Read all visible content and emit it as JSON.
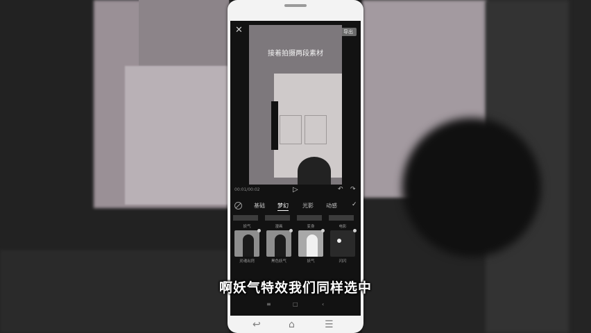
{
  "video": {
    "caption": "接着拍摄两段素材",
    "timecode": "00:01/00:02"
  },
  "toolbar": {
    "close_icon": "✕",
    "export_label": "导出"
  },
  "tabs": [
    "基础",
    "梦幻",
    "光影",
    "动感"
  ],
  "effects": {
    "row_labels": [
      "妖气",
      "漫画",
      "变身",
      "电影"
    ],
    "items": [
      {
        "name": "灵魂出窍"
      },
      {
        "name": "黑色妖气"
      },
      {
        "name": "妖气"
      },
      {
        "name": "闪闪"
      }
    ]
  },
  "subtitle": "啊妖气特效我们同样选中",
  "colors": {
    "screen": "#121212",
    "phone_body": "#f3f3f3"
  }
}
